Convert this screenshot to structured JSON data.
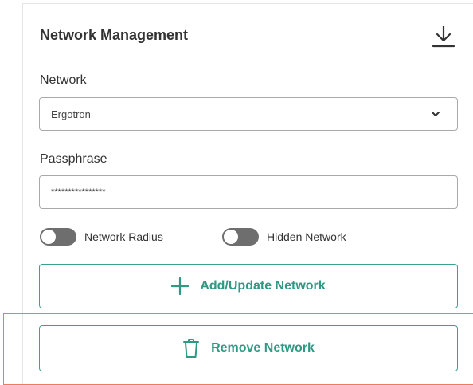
{
  "header": {
    "title": "Network Management",
    "download_icon": "download-icon"
  },
  "network": {
    "label": "Network",
    "selected": "Ergotron"
  },
  "passphrase": {
    "label": "Passphrase",
    "value": "****************"
  },
  "toggles": [
    {
      "label": "Network Radius",
      "on": false
    },
    {
      "label": "Hidden Network",
      "on": false
    }
  ],
  "buttons": {
    "add_update": "Add/Update Network",
    "remove": "Remove Network"
  },
  "colors": {
    "accent": "#3ba38d",
    "highlight": "#ee7b5b",
    "toggle_off": "#6e6e6e"
  }
}
